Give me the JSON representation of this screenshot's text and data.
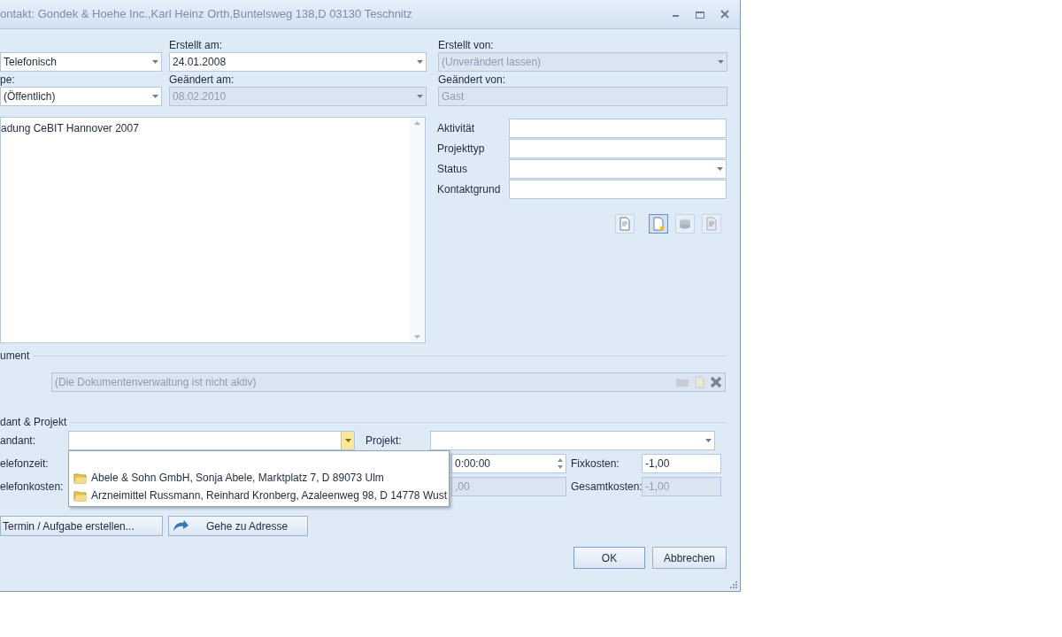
{
  "window": {
    "title": "ontakt: Gondek & Hoehe Inc.,Karl Heinz Orth,Buntelsweg 138,D 03130 Teschnitz"
  },
  "header": [
    {
      "cells": [
        {
          "value": "Telefonisch",
          "kind": "combo",
          "disabled": false
        },
        {
          "label": "Erstellt am:",
          "value": "24.01.2008",
          "kind": "combo",
          "disabled": false
        },
        {
          "label": "Erstellt von:",
          "value": "(Unverändert lassen)",
          "kind": "combo",
          "disabled": true
        }
      ]
    },
    {
      "cells": [
        {
          "label": "pe:",
          "value": "(Öffentlich)",
          "kind": "combo",
          "disabled": false
        },
        {
          "label": "Geändert am:",
          "value": "08.02.2010",
          "kind": "combo",
          "disabled": true
        },
        {
          "label": "Geändert von:",
          "value": "Gast",
          "kind": "text",
          "disabled": true
        }
      ]
    }
  ],
  "memo": {
    "text": "adung CeBIT Hannover 2007"
  },
  "details": [
    {
      "label": "Aktivität",
      "kind": "text"
    },
    {
      "label": "Projekttyp",
      "kind": "text"
    },
    {
      "label": "Status",
      "kind": "combo"
    },
    {
      "label": "Kontaktgrund",
      "kind": "text"
    }
  ],
  "tool_buttons": [
    {
      "selected": false
    },
    {
      "selected": true
    },
    {
      "selected": false
    },
    {
      "selected": false
    }
  ],
  "document": {
    "title": "ument",
    "value": "(Die Dokumentenverwaltung ist nicht aktiv)"
  },
  "mandant": {
    "title": "dant & Projekt",
    "mandant_label": "andant:",
    "projekt_label": "Projekt:",
    "telefonzeit_label": "elefonzeit:",
    "telefonzeit": "0:00:00",
    "fixkosten_label": "Fixkosten:",
    "fixkosten": "-1,00",
    "telefonkosten_label": "elefonkosten:",
    "telefonkosten": ",00",
    "gesamtkosten_label": "Gesamtkosten:",
    "gesamtkosten": "-1,00"
  },
  "dropdown": {
    "expanded": true,
    "items": [
      "Abele & Sohn GmbH, Sonja Abele, Marktplatz 7, D 89073 Ulm",
      "Arzneimittel Russmann, Reinhard Kronberg, Azaleenweg 98, D 14778 Wust"
    ]
  },
  "actions": [
    "Termin / Aufgabe erstellen...",
    "Gehe zu Adresse"
  ],
  "dialog_buttons": [
    "OK",
    "Abbrechen"
  ]
}
